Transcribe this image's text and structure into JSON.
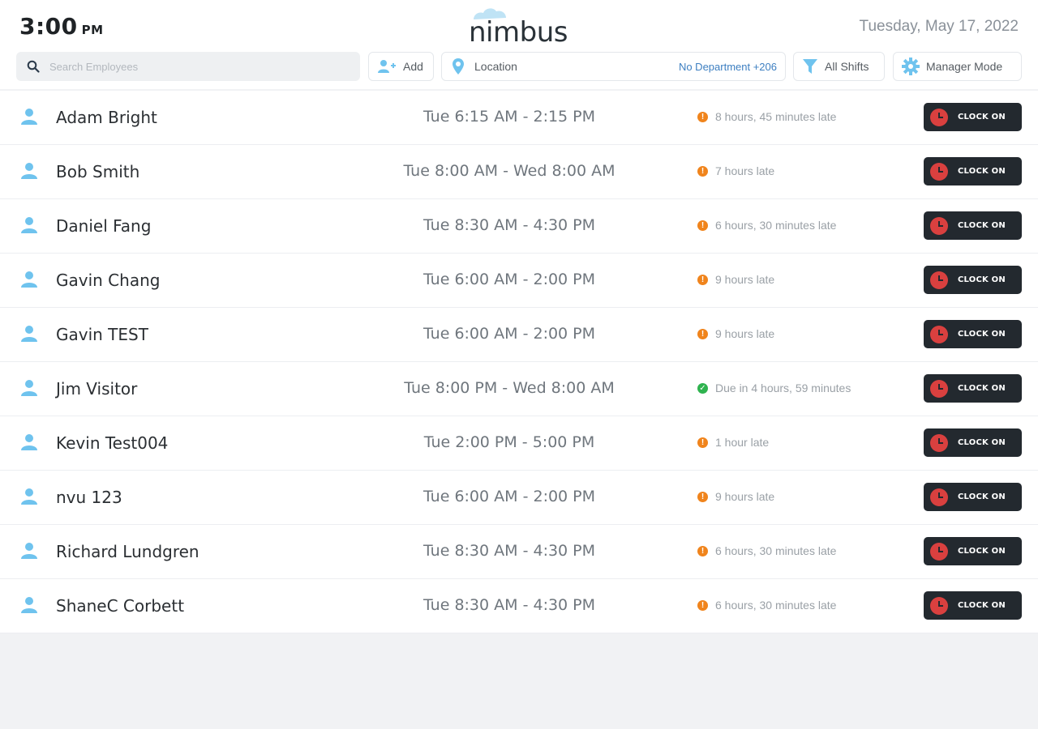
{
  "header": {
    "time": "3:00",
    "ampm": "PM",
    "logo": "nimbus",
    "date": "Tuesday, May 17, 2022"
  },
  "toolbar": {
    "search_placeholder": "Search Employees",
    "add_label": "Add",
    "location_label": "Location",
    "department_label": "No Department +206",
    "shifts_label": "All Shifts",
    "manager_label": "Manager Mode"
  },
  "colors": {
    "accent_blue": "#6fc3ee",
    "late_orange": "#f0841c",
    "ok_green": "#2fb34f",
    "button_dark": "#23292f",
    "clock_red": "#d9403f"
  },
  "clock_on_label": "CLOCK ON",
  "employees": [
    {
      "name": "Adam Bright",
      "shift": "Tue 6:15 AM - 2:15 PM",
      "status": "8 hours, 45 minutes late",
      "status_type": "late"
    },
    {
      "name": "Bob Smith",
      "shift": "Tue 8:00 AM - Wed 8:00 AM",
      "status": "7 hours late",
      "status_type": "late"
    },
    {
      "name": "Daniel Fang",
      "shift": "Tue 8:30 AM - 4:30 PM",
      "status": "6 hours, 30 minutes late",
      "status_type": "late"
    },
    {
      "name": "Gavin Chang",
      "shift": "Tue 6:00 AM - 2:00 PM",
      "status": "9 hours late",
      "status_type": "late"
    },
    {
      "name": "Gavin TEST",
      "shift": "Tue 6:00 AM - 2:00 PM",
      "status": "9 hours late",
      "status_type": "late"
    },
    {
      "name": "Jim Visitor",
      "shift": "Tue 8:00 PM - Wed 8:00 AM",
      "status": "Due in 4 hours, 59 minutes",
      "status_type": "ok"
    },
    {
      "name": "Kevin Test004",
      "shift": "Tue 2:00 PM - 5:00 PM",
      "status": "1 hour late",
      "status_type": "late"
    },
    {
      "name": "nvu 123",
      "shift": "Tue 6:00 AM - 2:00 PM",
      "status": "9 hours late",
      "status_type": "late"
    },
    {
      "name": "Richard Lundgren",
      "shift": "Tue 8:30 AM - 4:30 PM",
      "status": "6 hours, 30 minutes late",
      "status_type": "late"
    },
    {
      "name": "ShaneC Corbett",
      "shift": "Tue 8:30 AM - 4:30 PM",
      "status": "6 hours, 30 minutes late",
      "status_type": "late"
    }
  ]
}
